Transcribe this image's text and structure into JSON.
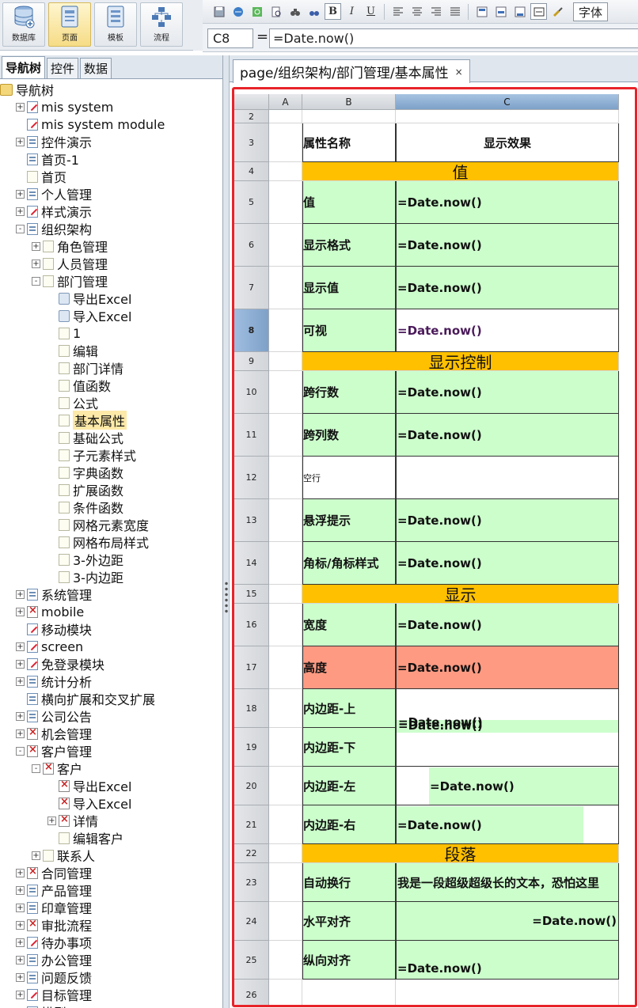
{
  "modules": [
    {
      "id": "db",
      "label": "数据库",
      "icon": "database-icon",
      "active": false
    },
    {
      "id": "page",
      "label": "页面",
      "icon": "page-icon",
      "active": true
    },
    {
      "id": "template",
      "label": "模板",
      "icon": "template-icon",
      "active": false
    },
    {
      "id": "flow",
      "label": "流程",
      "icon": "flow-icon",
      "active": false
    }
  ],
  "toolbar": {
    "bold": "B",
    "italic": "I",
    "underline": "U",
    "font_label": "字体"
  },
  "formula_bar": {
    "cell_ref": "C8",
    "equals": "=",
    "formula": "=Date.now()"
  },
  "nav_tabs": [
    {
      "label": "导航树",
      "active": true
    },
    {
      "label": "控件",
      "active": false
    },
    {
      "label": "数据",
      "active": false
    }
  ],
  "tree": [
    {
      "label": "导航树",
      "level": 0,
      "icon": "folder",
      "toggle": ""
    },
    {
      "label": "mis system",
      "level": 1,
      "icon": "edit",
      "toggle": "+"
    },
    {
      "label": "mis system  module",
      "level": 1,
      "icon": "edit",
      "toggle": ""
    },
    {
      "label": "控件演示",
      "level": 1,
      "icon": "page",
      "toggle": "+"
    },
    {
      "label": "首页-1",
      "level": 1,
      "icon": "page",
      "toggle": ""
    },
    {
      "label": "首页",
      "level": 1,
      "icon": "doc",
      "toggle": ""
    },
    {
      "label": "个人管理",
      "level": 1,
      "icon": "page",
      "toggle": "+"
    },
    {
      "label": "样式演示",
      "level": 1,
      "icon": "edit",
      "toggle": "+"
    },
    {
      "label": "组织架构",
      "level": 1,
      "icon": "page",
      "toggle": "-"
    },
    {
      "label": "角色管理",
      "level": 2,
      "icon": "doc",
      "toggle": "+"
    },
    {
      "label": "人员管理",
      "level": 2,
      "icon": "doc",
      "toggle": "+"
    },
    {
      "label": "部门管理",
      "level": 2,
      "icon": "doc",
      "toggle": "-"
    },
    {
      "label": "导出Excel",
      "level": 3,
      "icon": "export",
      "toggle": ""
    },
    {
      "label": "导入Excel",
      "level": 3,
      "icon": "export",
      "toggle": ""
    },
    {
      "label": "1",
      "level": 3,
      "icon": "doc",
      "toggle": ""
    },
    {
      "label": "编辑",
      "level": 3,
      "icon": "doc",
      "toggle": ""
    },
    {
      "label": "部门详情",
      "level": 3,
      "icon": "doc",
      "toggle": ""
    },
    {
      "label": "值函数",
      "level": 3,
      "icon": "doc",
      "toggle": ""
    },
    {
      "label": "公式",
      "level": 3,
      "icon": "doc",
      "toggle": ""
    },
    {
      "label": "基本属性",
      "level": 3,
      "icon": "doc",
      "toggle": "",
      "selected": true
    },
    {
      "label": "基础公式",
      "level": 3,
      "icon": "doc",
      "toggle": ""
    },
    {
      "label": "子元素样式",
      "level": 3,
      "icon": "doc",
      "toggle": ""
    },
    {
      "label": "字典函数",
      "level": 3,
      "icon": "doc",
      "toggle": ""
    },
    {
      "label": "扩展函数",
      "level": 3,
      "icon": "doc",
      "toggle": ""
    },
    {
      "label": "条件函数",
      "level": 3,
      "icon": "doc",
      "toggle": ""
    },
    {
      "label": "网格元素宽度",
      "level": 3,
      "icon": "doc",
      "toggle": ""
    },
    {
      "label": "网格布局样式",
      "level": 3,
      "icon": "doc",
      "toggle": ""
    },
    {
      "label": "3-外边距",
      "level": 3,
      "icon": "doc",
      "toggle": ""
    },
    {
      "label": "3-内边距",
      "level": 3,
      "icon": "doc",
      "toggle": ""
    },
    {
      "label": "系统管理",
      "level": 1,
      "icon": "page",
      "toggle": "+"
    },
    {
      "label": "mobile",
      "level": 1,
      "icon": "mobile",
      "toggle": "+"
    },
    {
      "label": "移动模块",
      "level": 1,
      "icon": "edit",
      "toggle": ""
    },
    {
      "label": "screen",
      "level": 1,
      "icon": "edit",
      "toggle": "+"
    },
    {
      "label": "免登录模块",
      "level": 1,
      "icon": "edit",
      "toggle": "+"
    },
    {
      "label": "统计分析",
      "level": 1,
      "icon": "page",
      "toggle": "+"
    },
    {
      "label": "横向扩展和交叉扩展",
      "level": 1,
      "icon": "page",
      "toggle": ""
    },
    {
      "label": "公司公告",
      "level": 1,
      "icon": "page",
      "toggle": "+"
    },
    {
      "label": "机会管理",
      "level": 1,
      "icon": "mobile",
      "toggle": "+"
    },
    {
      "label": "客户管理",
      "level": 1,
      "icon": "mobile",
      "toggle": "-"
    },
    {
      "label": "客户",
      "level": 2,
      "icon": "mobile",
      "toggle": "-"
    },
    {
      "label": "导出Excel",
      "level": 3,
      "icon": "mobile",
      "toggle": ""
    },
    {
      "label": "导入Excel",
      "level": 3,
      "icon": "mobile",
      "toggle": ""
    },
    {
      "label": "详情",
      "level": 3,
      "icon": "mobile",
      "toggle": "+"
    },
    {
      "label": "编辑客户",
      "level": 3,
      "icon": "doc",
      "toggle": ""
    },
    {
      "label": "联系人",
      "level": 2,
      "icon": "doc",
      "toggle": "+"
    },
    {
      "label": "合同管理",
      "level": 1,
      "icon": "mobile",
      "toggle": "+"
    },
    {
      "label": "产品管理",
      "level": 1,
      "icon": "page",
      "toggle": "+"
    },
    {
      "label": "印章管理",
      "level": 1,
      "icon": "page",
      "toggle": "+"
    },
    {
      "label": "审批流程",
      "level": 1,
      "icon": "mobile",
      "toggle": "+"
    },
    {
      "label": "待办事项",
      "level": 1,
      "icon": "edit",
      "toggle": "+"
    },
    {
      "label": "办公管理",
      "level": 1,
      "icon": "page",
      "toggle": "+"
    },
    {
      "label": "问题反馈",
      "level": 1,
      "icon": "page",
      "toggle": "+"
    },
    {
      "label": "目标管理",
      "level": 1,
      "icon": "edit",
      "toggle": "+"
    },
    {
      "label": "模型",
      "level": 1,
      "icon": "page",
      "toggle": "+"
    }
  ],
  "editor_tab": {
    "title": "page/组织架构/部门管理/基本属性",
    "close": "×"
  },
  "sheet": {
    "columns": [
      {
        "name": "",
        "active": false
      },
      {
        "name": "A",
        "active": false
      },
      {
        "name": "B",
        "active": false
      },
      {
        "name": "C",
        "active": true
      }
    ],
    "header_row": {
      "num": "3",
      "b": "属性名称",
      "c": "显示效果"
    },
    "rows": [
      {
        "num": "2",
        "type": "blank"
      },
      {
        "num": "3",
        "type": "header"
      },
      {
        "num": "4",
        "type": "section",
        "text": "值"
      },
      {
        "num": "5",
        "type": "prop",
        "b": "值",
        "c": "=Date.now()",
        "style": "green"
      },
      {
        "num": "6",
        "type": "prop",
        "b": "显示格式",
        "c": "=Date.now()",
        "style": "green"
      },
      {
        "num": "7",
        "type": "prop",
        "b": "显示值",
        "c": "=Date.now()",
        "style": "green"
      },
      {
        "num": "8",
        "type": "prop",
        "b": "可视",
        "c": "=Date.now()",
        "style": "green-b",
        "active": true
      },
      {
        "num": "9",
        "type": "section",
        "text": "显示控制"
      },
      {
        "num": "10",
        "type": "prop",
        "b": "跨行数",
        "c": "=Date.now()",
        "style": "green"
      },
      {
        "num": "11",
        "type": "prop",
        "b": "跨列数",
        "c": "=Date.now()",
        "style": "green"
      },
      {
        "num": "12",
        "type": "plain",
        "b": "空行"
      },
      {
        "num": "13",
        "type": "prop",
        "b": "悬浮提示",
        "c": "=Date.now()",
        "style": "green"
      },
      {
        "num": "14",
        "type": "prop",
        "b": "角标/角标样式",
        "c": "=Date.now()",
        "style": "green"
      },
      {
        "num": "15",
        "type": "section",
        "text": "显示"
      },
      {
        "num": "16",
        "type": "prop",
        "b": "宽度",
        "c": "=Date.now()",
        "style": "green"
      },
      {
        "num": "17",
        "type": "prop",
        "b": "高度",
        "c": "=Date.now()",
        "style": "red"
      },
      {
        "num": "18",
        "type": "padding-top",
        "b": "内边距-上"
      },
      {
        "num": "19",
        "type": "padding-bottom",
        "b": "内边距-下"
      },
      {
        "num": "20",
        "type": "padding-left",
        "b": "内边距-左",
        "c": "=Date.now()"
      },
      {
        "num": "21",
        "type": "padding-right",
        "b": "内边距-右",
        "c": "=Date.now()"
      },
      {
        "num": "22",
        "type": "section",
        "text": "段落"
      },
      {
        "num": "23",
        "type": "prop",
        "b": "自动换行",
        "c": "我是一段超级超级长的文本，恐怕这里",
        "style": "green"
      },
      {
        "num": "24",
        "type": "prop",
        "b": "水平对齐",
        "c": "=Date.now()",
        "style": "green-right"
      },
      {
        "num": "25",
        "type": "prop",
        "b": "纵向对齐",
        "c": "=Date.now()",
        "style": "green-bottom"
      },
      {
        "num": "26",
        "type": "blank"
      }
    ],
    "merged_padding_value": "=Date.now()",
    "merged_padding_ghost": "=Date.now()"
  },
  "colors": {
    "accent_red": "#e8232a",
    "section_orange": "#ffc000",
    "cell_green": "#ccfecc",
    "cell_red": "#ff9a82",
    "header_blue": "#7da1c8"
  }
}
